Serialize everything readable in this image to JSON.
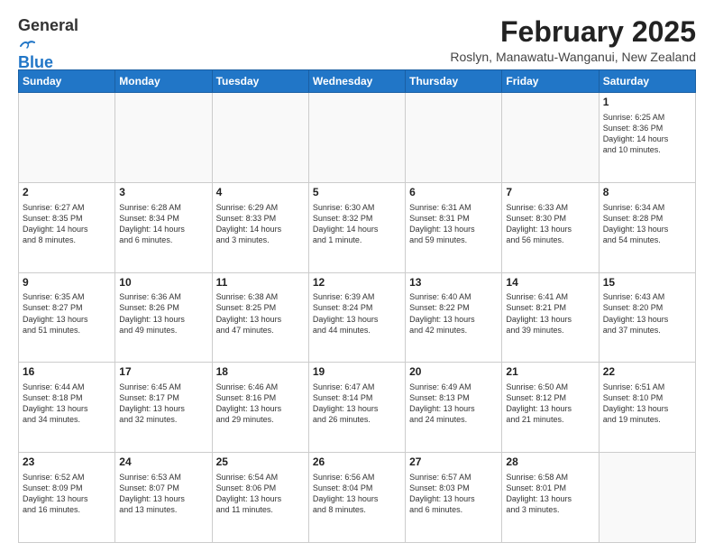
{
  "header": {
    "logo_line1": "General",
    "logo_line2": "Blue",
    "month": "February 2025",
    "location": "Roslyn, Manawatu-Wanganui, New Zealand"
  },
  "weekdays": [
    "Sunday",
    "Monday",
    "Tuesday",
    "Wednesday",
    "Thursday",
    "Friday",
    "Saturday"
  ],
  "weeks": [
    [
      {
        "day": "",
        "info": ""
      },
      {
        "day": "",
        "info": ""
      },
      {
        "day": "",
        "info": ""
      },
      {
        "day": "",
        "info": ""
      },
      {
        "day": "",
        "info": ""
      },
      {
        "day": "",
        "info": ""
      },
      {
        "day": "1",
        "info": "Sunrise: 6:25 AM\nSunset: 8:36 PM\nDaylight: 14 hours\nand 10 minutes."
      }
    ],
    [
      {
        "day": "2",
        "info": "Sunrise: 6:27 AM\nSunset: 8:35 PM\nDaylight: 14 hours\nand 8 minutes."
      },
      {
        "day": "3",
        "info": "Sunrise: 6:28 AM\nSunset: 8:34 PM\nDaylight: 14 hours\nand 6 minutes."
      },
      {
        "day": "4",
        "info": "Sunrise: 6:29 AM\nSunset: 8:33 PM\nDaylight: 14 hours\nand 3 minutes."
      },
      {
        "day": "5",
        "info": "Sunrise: 6:30 AM\nSunset: 8:32 PM\nDaylight: 14 hours\nand 1 minute."
      },
      {
        "day": "6",
        "info": "Sunrise: 6:31 AM\nSunset: 8:31 PM\nDaylight: 13 hours\nand 59 minutes."
      },
      {
        "day": "7",
        "info": "Sunrise: 6:33 AM\nSunset: 8:30 PM\nDaylight: 13 hours\nand 56 minutes."
      },
      {
        "day": "8",
        "info": "Sunrise: 6:34 AM\nSunset: 8:28 PM\nDaylight: 13 hours\nand 54 minutes."
      }
    ],
    [
      {
        "day": "9",
        "info": "Sunrise: 6:35 AM\nSunset: 8:27 PM\nDaylight: 13 hours\nand 51 minutes."
      },
      {
        "day": "10",
        "info": "Sunrise: 6:36 AM\nSunset: 8:26 PM\nDaylight: 13 hours\nand 49 minutes."
      },
      {
        "day": "11",
        "info": "Sunrise: 6:38 AM\nSunset: 8:25 PM\nDaylight: 13 hours\nand 47 minutes."
      },
      {
        "day": "12",
        "info": "Sunrise: 6:39 AM\nSunset: 8:24 PM\nDaylight: 13 hours\nand 44 minutes."
      },
      {
        "day": "13",
        "info": "Sunrise: 6:40 AM\nSunset: 8:22 PM\nDaylight: 13 hours\nand 42 minutes."
      },
      {
        "day": "14",
        "info": "Sunrise: 6:41 AM\nSunset: 8:21 PM\nDaylight: 13 hours\nand 39 minutes."
      },
      {
        "day": "15",
        "info": "Sunrise: 6:43 AM\nSunset: 8:20 PM\nDaylight: 13 hours\nand 37 minutes."
      }
    ],
    [
      {
        "day": "16",
        "info": "Sunrise: 6:44 AM\nSunset: 8:18 PM\nDaylight: 13 hours\nand 34 minutes."
      },
      {
        "day": "17",
        "info": "Sunrise: 6:45 AM\nSunset: 8:17 PM\nDaylight: 13 hours\nand 32 minutes."
      },
      {
        "day": "18",
        "info": "Sunrise: 6:46 AM\nSunset: 8:16 PM\nDaylight: 13 hours\nand 29 minutes."
      },
      {
        "day": "19",
        "info": "Sunrise: 6:47 AM\nSunset: 8:14 PM\nDaylight: 13 hours\nand 26 minutes."
      },
      {
        "day": "20",
        "info": "Sunrise: 6:49 AM\nSunset: 8:13 PM\nDaylight: 13 hours\nand 24 minutes."
      },
      {
        "day": "21",
        "info": "Sunrise: 6:50 AM\nSunset: 8:12 PM\nDaylight: 13 hours\nand 21 minutes."
      },
      {
        "day": "22",
        "info": "Sunrise: 6:51 AM\nSunset: 8:10 PM\nDaylight: 13 hours\nand 19 minutes."
      }
    ],
    [
      {
        "day": "23",
        "info": "Sunrise: 6:52 AM\nSunset: 8:09 PM\nDaylight: 13 hours\nand 16 minutes."
      },
      {
        "day": "24",
        "info": "Sunrise: 6:53 AM\nSunset: 8:07 PM\nDaylight: 13 hours\nand 13 minutes."
      },
      {
        "day": "25",
        "info": "Sunrise: 6:54 AM\nSunset: 8:06 PM\nDaylight: 13 hours\nand 11 minutes."
      },
      {
        "day": "26",
        "info": "Sunrise: 6:56 AM\nSunset: 8:04 PM\nDaylight: 13 hours\nand 8 minutes."
      },
      {
        "day": "27",
        "info": "Sunrise: 6:57 AM\nSunset: 8:03 PM\nDaylight: 13 hours\nand 6 minutes."
      },
      {
        "day": "28",
        "info": "Sunrise: 6:58 AM\nSunset: 8:01 PM\nDaylight: 13 hours\nand 3 minutes."
      },
      {
        "day": "",
        "info": ""
      }
    ]
  ]
}
